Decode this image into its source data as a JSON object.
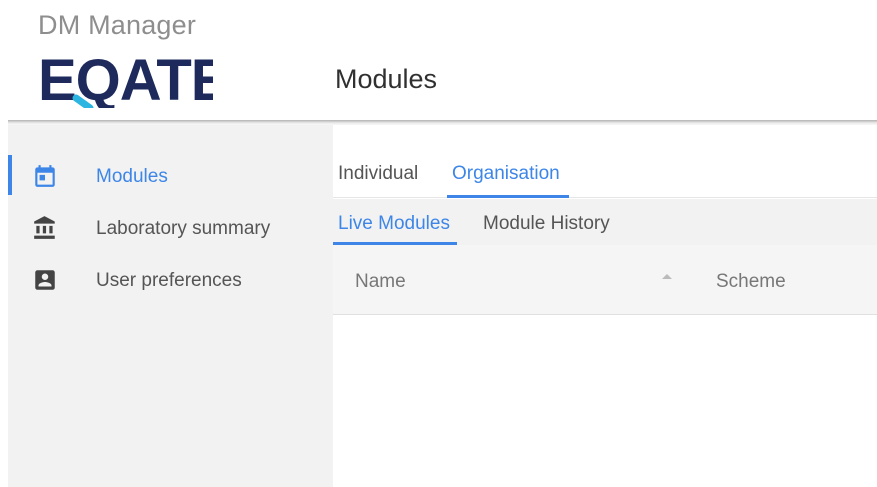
{
  "header": {
    "app_name": "DM Manager",
    "logo_text": "EQATE",
    "page_title": "Modules"
  },
  "sidebar": {
    "items": [
      {
        "label": "Modules",
        "icon": "calendar-icon",
        "active": true
      },
      {
        "label": "Laboratory summary",
        "icon": "bank-icon",
        "active": false
      },
      {
        "label": "User preferences",
        "icon": "account-box-icon",
        "active": false
      }
    ]
  },
  "main": {
    "tabs": [
      {
        "label": "Individual",
        "active": false
      },
      {
        "label": "Organisation",
        "active": true
      }
    ],
    "sub_tabs": [
      {
        "label": "Live Modules",
        "active": true
      },
      {
        "label": "Module History",
        "active": false
      }
    ],
    "table": {
      "columns": [
        "Name",
        "Scheme"
      ],
      "sort_column": "Name",
      "sort_direction": "ascending",
      "rows": []
    }
  },
  "colors": {
    "accent": "#3d86e8",
    "logo_navy": "#1d2a5b",
    "logo_cyan": "#2bb5e0",
    "sidebar_bg": "#f2f2f2",
    "muted_text": "#8e8e8e"
  }
}
